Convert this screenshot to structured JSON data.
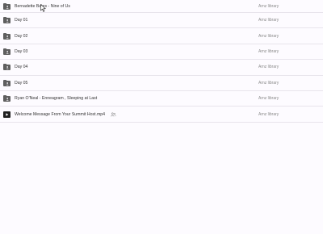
{
  "files": [
    {
      "name": "Bernadette Bates - Nine of Us",
      "owner": "Arnz library",
      "icon": "shared-folder-icon"
    },
    {
      "name": "Day 01",
      "owner": "Arnz library",
      "icon": "shared-folder-icon"
    },
    {
      "name": "Day 02",
      "owner": "Arnz library",
      "icon": "shared-folder-icon"
    },
    {
      "name": "Day 03",
      "owner": "Arnz library",
      "icon": "shared-folder-icon"
    },
    {
      "name": "Day 04",
      "owner": "Arnz library",
      "icon": "shared-folder-icon"
    },
    {
      "name": "Day 05",
      "owner": "Arnz library",
      "icon": "shared-folder-icon"
    },
    {
      "name": "Ryan O'Neal - Enneagram , Sleeping at Last",
      "owner": "Arnz library",
      "icon": "shared-folder-icon"
    },
    {
      "name": "Welcome Message From Your Summit Host.mp4",
      "owner": "Arnz library",
      "icon": "video-file-icon",
      "shared_icon": "shared-people-icon"
    }
  ]
}
